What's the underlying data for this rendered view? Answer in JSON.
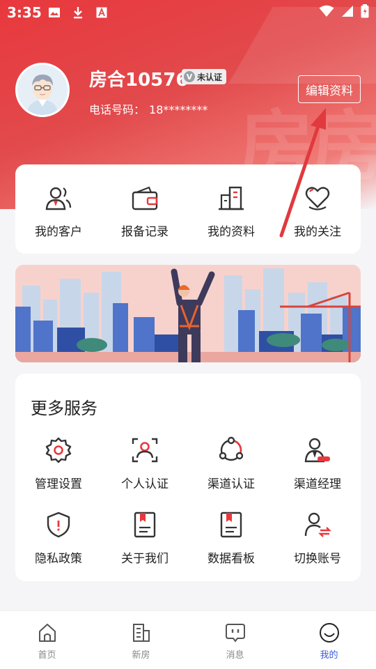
{
  "status_bar": {
    "time": "3:35",
    "left_icons": [
      "image-icon",
      "download-icon",
      "font-icon"
    ],
    "right_icons": [
      "wifi-icon",
      "signal-icon",
      "battery-icon"
    ]
  },
  "profile": {
    "name": "房合10576",
    "verify_badge": "未认证",
    "verify_badge_mark": "V",
    "phone_label": "电话号码：",
    "phone_value": "18********",
    "edit_button": "编辑资料"
  },
  "header_watermark": "房房",
  "quick_actions": [
    {
      "label": "我的客户",
      "icon": "customers-icon"
    },
    {
      "label": "报备记录",
      "icon": "wallet-icon"
    },
    {
      "label": "我的资料",
      "icon": "building-icon"
    },
    {
      "label": "我的关注",
      "icon": "heart-icon"
    }
  ],
  "services": {
    "title": "更多服务",
    "items": [
      {
        "label": "管理设置",
        "icon": "gear-icon"
      },
      {
        "label": "个人认证",
        "icon": "person-scan-icon"
      },
      {
        "label": "渠道认证",
        "icon": "channel-network-icon"
      },
      {
        "label": "渠道经理",
        "icon": "manager-icon"
      },
      {
        "label": "隐私政策",
        "icon": "shield-icon"
      },
      {
        "label": "关于我们",
        "icon": "book-icon"
      },
      {
        "label": "数据看板",
        "icon": "dashboard-book-icon"
      },
      {
        "label": "切换账号",
        "icon": "switch-account-icon"
      }
    ]
  },
  "tabbar": {
    "items": [
      {
        "label": "首页",
        "icon": "home-icon",
        "active": false
      },
      {
        "label": "新房",
        "icon": "new-house-icon",
        "active": false
      },
      {
        "label": "消息",
        "icon": "message-icon",
        "active": false
      },
      {
        "label": "我的",
        "icon": "smile-icon",
        "active": true
      }
    ]
  },
  "colors": {
    "brand_red": "#e8383d",
    "active_tab": "#3a5bd9",
    "icon_dark": "#333333"
  }
}
